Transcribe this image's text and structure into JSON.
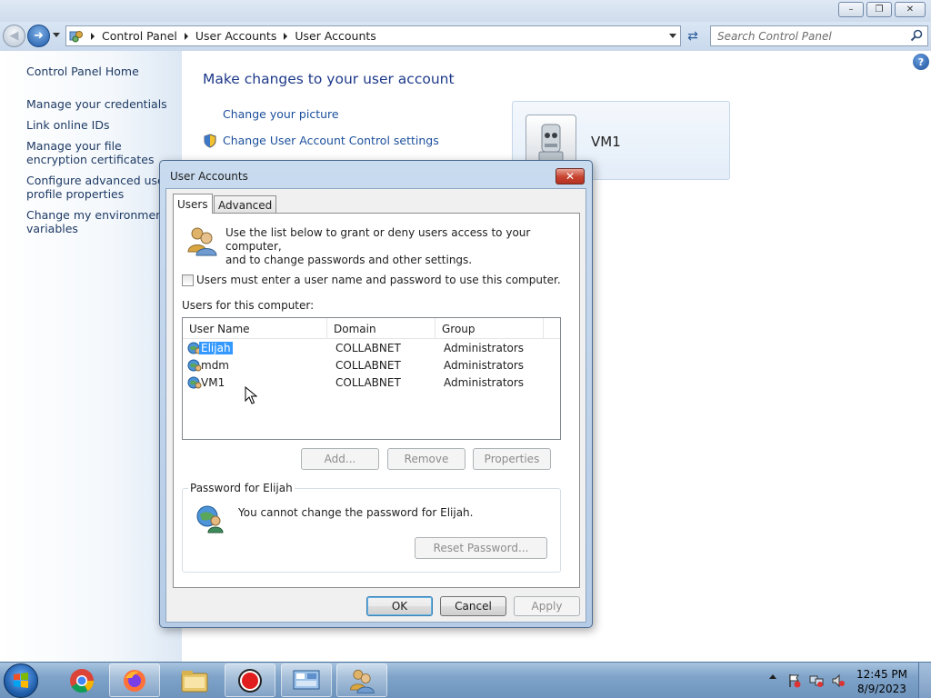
{
  "window": {
    "minimize_glyph": "–",
    "maximize_glyph": "❐",
    "close_glyph": "✕"
  },
  "navigation": {
    "breadcrumbs": [
      "Control Panel",
      "User Accounts",
      "User Accounts"
    ],
    "search_placeholder": "Search Control Panel"
  },
  "sidebar": {
    "items": [
      "Control Panel Home",
      "Manage your credentials",
      "Link online IDs",
      "Manage your file encryption certificates",
      "Configure advanced user profile properties",
      "Change my environment variables"
    ]
  },
  "main": {
    "title": "Make changes to your user account",
    "tasks": [
      "Change your picture",
      "Change User Account Control settings"
    ],
    "account_name": "VM1"
  },
  "dialog": {
    "title": "User Accounts",
    "tabs": [
      "Users",
      "Advanced"
    ],
    "intro_line1": "Use the list below to grant or deny users access to your computer,",
    "intro_line2": "and to change passwords and other settings.",
    "checkbox_label": "Users must enter a user name and password to use this computer.",
    "checkbox_checked": false,
    "users_label": "Users for this computer:",
    "columns": [
      "User Name",
      "Domain",
      "Group"
    ],
    "rows": [
      {
        "name": "Elijah",
        "domain": "COLLABNET",
        "group": "Administrators",
        "selected": true
      },
      {
        "name": "mdm",
        "domain": "COLLABNET",
        "group": "Administrators",
        "selected": false
      },
      {
        "name": "VM1",
        "domain": "COLLABNET",
        "group": "Administrators",
        "selected": false
      }
    ],
    "buttons": {
      "add": "Add...",
      "remove": "Remove",
      "properties": "Properties"
    },
    "password_group_title": "Password for Elijah",
    "password_text": "You cannot change the password for Elijah.",
    "reset_button": "Reset Password...",
    "footer": {
      "ok": "OK",
      "cancel": "Cancel",
      "apply": "Apply"
    }
  },
  "taskbar": {
    "time": "12:45 PM",
    "date": "8/9/2023",
    "apps": [
      "chrome-icon",
      "firefox-icon",
      "explorer-icon",
      "record-icon",
      "control-panel-icon",
      "user-accounts-icon"
    ]
  },
  "colors": {
    "selection": "#3399ff",
    "link": "#1b4f9c",
    "title": "#1e3a8a",
    "close_red": "#c7412e"
  }
}
